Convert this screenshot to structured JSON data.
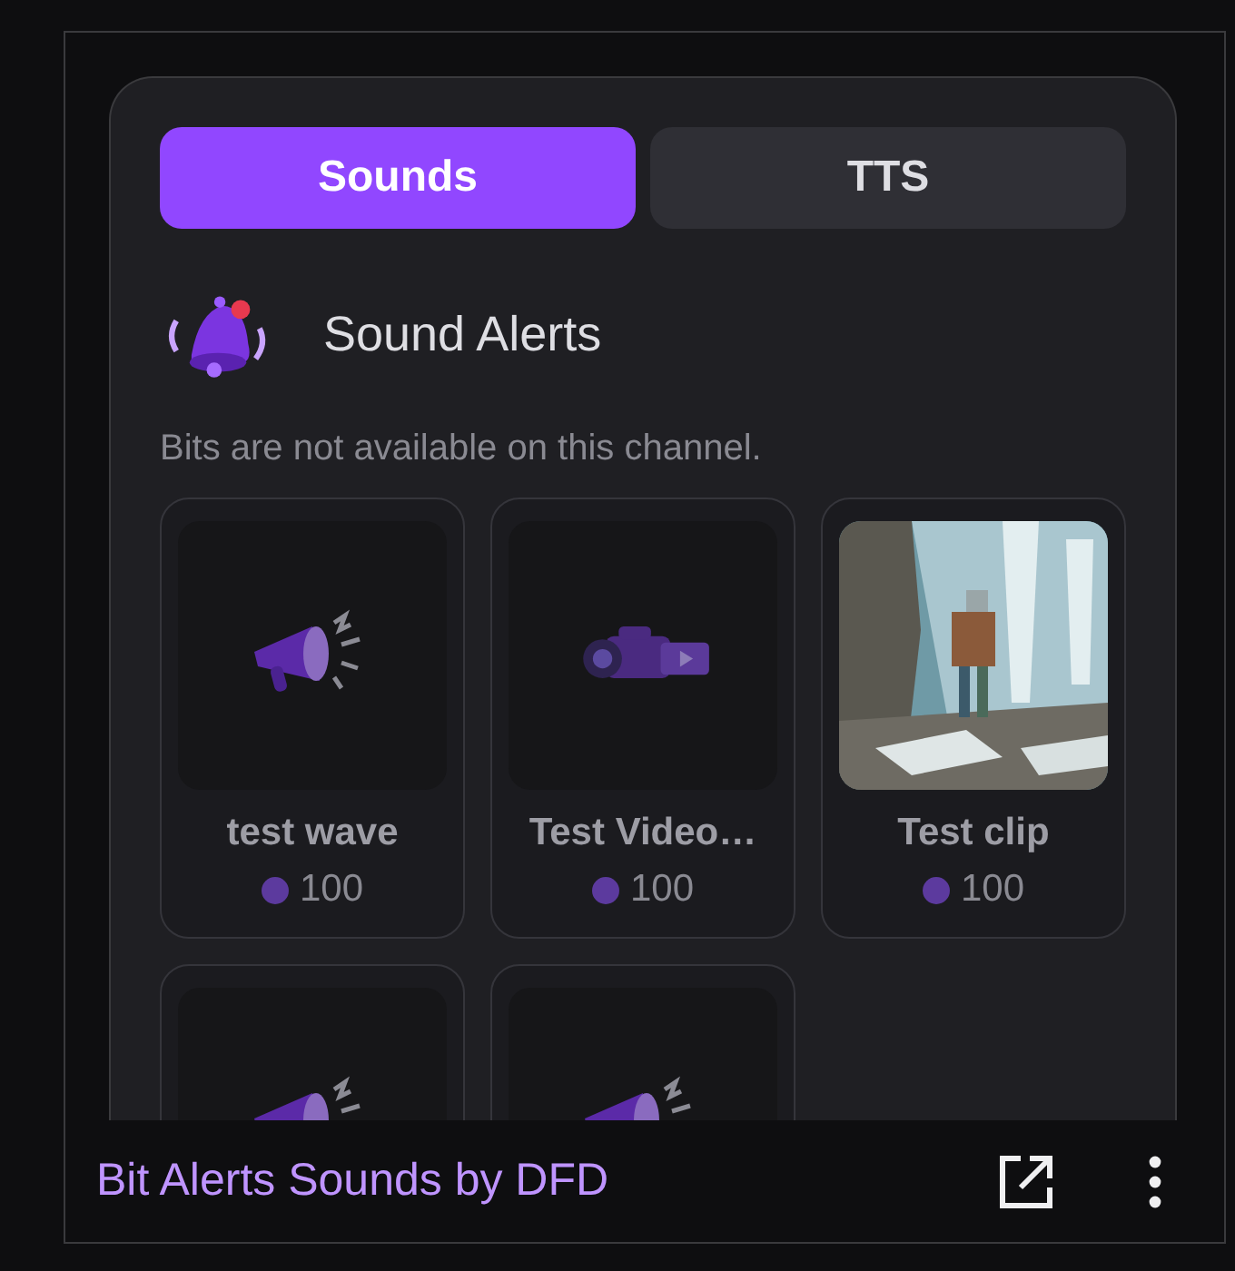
{
  "tabs": [
    {
      "label": "Sounds",
      "selected": true
    },
    {
      "label": "TTS",
      "selected": false
    }
  ],
  "header": {
    "title": "Sound Alerts"
  },
  "notice": "Bits are not available on this channel.",
  "items": [
    {
      "kind": "megaphone",
      "name": "test wave",
      "price": "100"
    },
    {
      "kind": "camera",
      "name": "Test Video…",
      "price": "100"
    },
    {
      "kind": "picture",
      "name": "Test clip",
      "price": "100"
    },
    {
      "kind": "megaphone"
    },
    {
      "kind": "megaphone"
    }
  ],
  "footer": {
    "title": "Bit Alerts Sounds by DFD"
  }
}
